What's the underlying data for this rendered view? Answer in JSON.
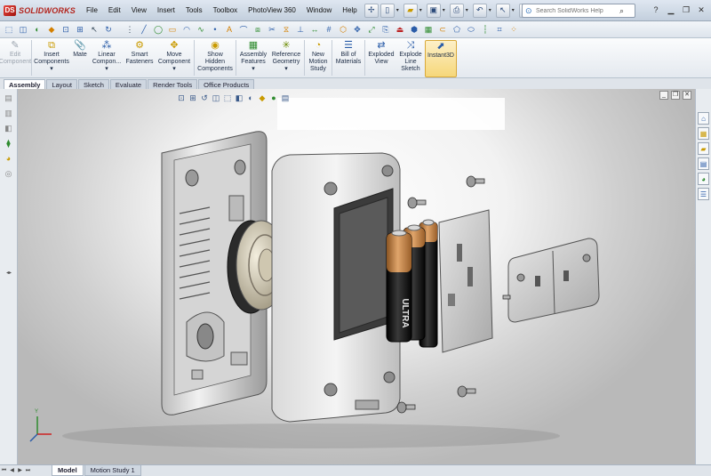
{
  "app": {
    "logo_text": "SOLIDWORKS"
  },
  "menu": [
    "File",
    "Edit",
    "View",
    "Insert",
    "Tools",
    "Toolbox",
    "PhotoView 360",
    "Window",
    "Help"
  ],
  "search": {
    "placeholder": "Search SolidWorks Help"
  },
  "ribbon": [
    {
      "id": "edit-component",
      "label": "Edit\nComponent",
      "icon": "edit-component-icon",
      "disabled": true,
      "glyph": "✎"
    },
    {
      "id": "insert-components",
      "label": "Insert\nComponents\n▾",
      "icon": "insert-components-icon",
      "glyph": "⧉"
    },
    {
      "id": "mate",
      "label": "Mate",
      "icon": "mate-icon",
      "glyph": "📎"
    },
    {
      "id": "linear-component",
      "label": "Linear\nCompon...\n▾",
      "icon": "linear-pattern-icon",
      "glyph": "⁂"
    },
    {
      "id": "smart-fasteners",
      "label": "Smart\nFasteners",
      "icon": "smart-fasteners-icon",
      "glyph": "⚙"
    },
    {
      "id": "move-component",
      "label": "Move\nComponent\n▾",
      "icon": "move-component-icon",
      "glyph": "✥"
    },
    {
      "id": "show-hidden",
      "label": "Show\nHidden\nComponents",
      "icon": "show-hidden-icon",
      "glyph": "◉"
    },
    {
      "id": "assembly-features",
      "label": "Assembly\nFeatures\n▾",
      "icon": "assembly-features-icon",
      "glyph": "▦"
    },
    {
      "id": "reference-geometry",
      "label": "Reference\nGeometry\n▾",
      "icon": "reference-geometry-icon",
      "glyph": "✳"
    },
    {
      "id": "new-motion-study",
      "label": "New\nMotion\nStudy",
      "icon": "motion-study-icon",
      "glyph": "◔"
    },
    {
      "id": "bill-of-materials",
      "label": "Bill of\nMaterials",
      "icon": "bill-of-materials-icon",
      "glyph": "☰"
    },
    {
      "id": "exploded-view",
      "label": "Exploded\nView",
      "icon": "exploded-view-icon",
      "glyph": "⇄"
    },
    {
      "id": "explode-line-sketch",
      "label": "Explode\nLine\nSketch",
      "icon": "explode-line-sketch-icon",
      "glyph": "⤨"
    },
    {
      "id": "instant3d",
      "label": "Instant3D",
      "icon": "instant3d-icon",
      "glyph": "⬈",
      "active": true
    }
  ],
  "tabs": [
    {
      "label": "Assembly",
      "active": true
    },
    {
      "label": "Layout"
    },
    {
      "label": "Sketch"
    },
    {
      "label": "Evaluate"
    },
    {
      "label": "Render Tools"
    },
    {
      "label": "Office Products"
    }
  ],
  "battery": {
    "label": "ULTRA"
  },
  "bottom_tabs": [
    {
      "label": "Model",
      "active": true
    },
    {
      "label": "Motion Study 1"
    }
  ],
  "colors": {
    "accent": "#2a5ca8",
    "active_button": "#f6d77a",
    "battery_copper": "#c8874a",
    "battery_black": "#111111"
  }
}
